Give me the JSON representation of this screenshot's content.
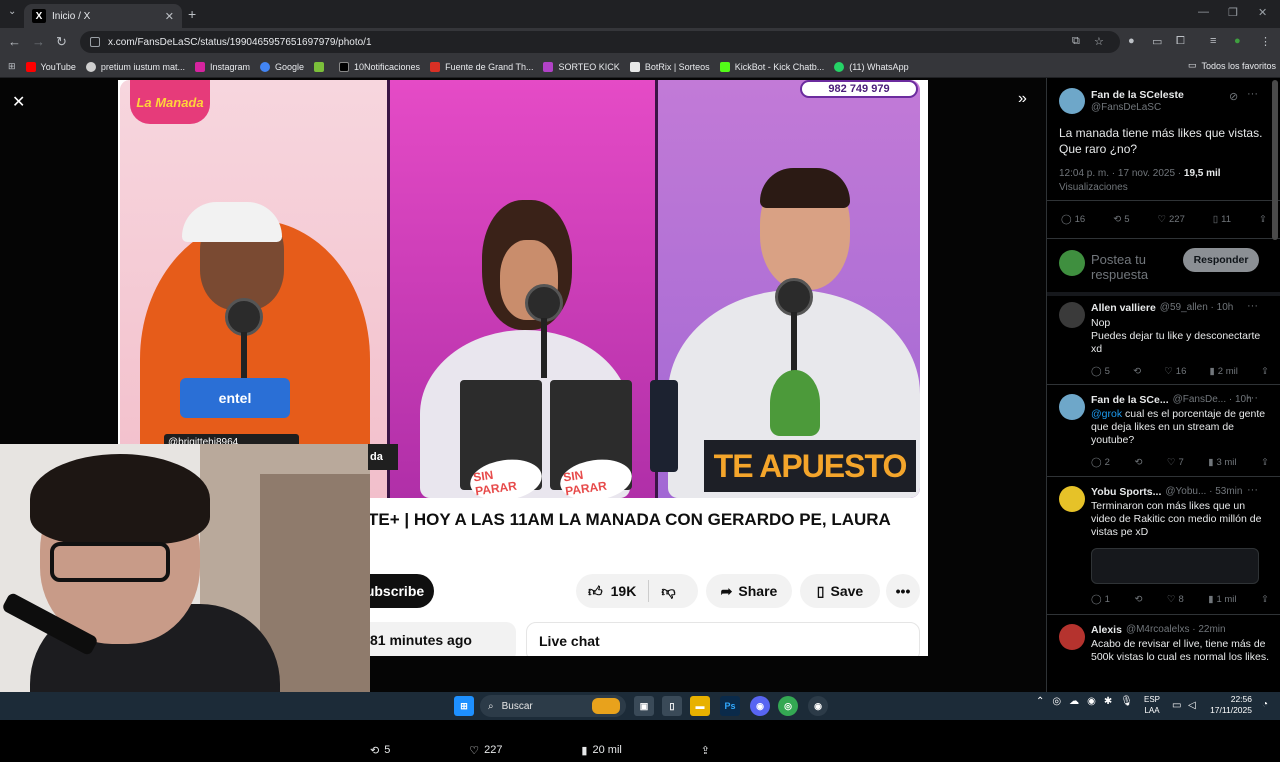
{
  "browser": {
    "tab_title": "Inicio / X",
    "url": "x.com/FansDeLaSC/status/1990465957651697979/photo/1",
    "bookmarks": [
      {
        "label": "YouTube",
        "color": "#ff0000"
      },
      {
        "label": "pretium iustum mat...",
        "color": "#cfcfcf"
      },
      {
        "label": "Instagram",
        "color": "#d6249f"
      },
      {
        "label": "Google",
        "color": "#4285f4"
      },
      {
        "label": "",
        "color": "#7bbf3a"
      },
      {
        "label": "10Notificaciones",
        "color": "#000000"
      },
      {
        "label": "Fuente de Grand Th...",
        "color": "#d93025"
      },
      {
        "label": "SORTEO KICK",
        "color": "#b142c7"
      },
      {
        "label": "BotRix | Sorteos",
        "color": "#e8e8e8"
      },
      {
        "label": "KickBot - Kick Chatb...",
        "color": "#53fc18"
      },
      {
        "label": "(11) WhatsApp",
        "color": "#25d366"
      }
    ],
    "all_bookmarks": "Todos los favoritos"
  },
  "stream": {
    "logo": "La Manada",
    "phone": "982 749 979",
    "sponsor": "entel",
    "overlay_user": "@brigittehj8964",
    "left_caption": "da",
    "show_name": "TE APUESTO",
    "product": "SIN PARAR"
  },
  "youtube": {
    "title": "TE+ | HOY A LAS 11AM LA MANADA CON GERARDO PE, LAURA",
    "subscribe": "ubscribe",
    "likes": "19K",
    "share": "Share",
    "save": "Save",
    "time_ago": "81 minutes ago",
    "live_chat": "Live chat"
  },
  "photo_actions": {
    "reposts": "5",
    "likes": "227",
    "views": "20 mil"
  },
  "tweet": {
    "author_name": "Fan de la SCeleste",
    "author_handle": "@FansDeLaSC",
    "text": "La manada tiene más likes que vistas. Que raro ¿no?",
    "timestamp": "12:04 p. m. · 17 nov. 2025 · ",
    "views_count": "19,5 mil",
    "views_label": "Visualizaciones",
    "replies": "16",
    "reposts": "5",
    "likes": "227",
    "bookmarks": "11",
    "compose_placeholder": "Postea tu respuesta",
    "reply_button": "Responder"
  },
  "replies": [
    {
      "name": "Allen valliere",
      "handle": "@59_allen · 10h",
      "mention": "",
      "text": "Nop\nPuedes dejar tu like y desconectarte xd",
      "replies": "5",
      "reposts": "",
      "likes": "16",
      "views": "2 mil",
      "avatar_color": "dark"
    },
    {
      "name": "Fan de la SCe...",
      "handle": "@FansDe... · 10h",
      "mention": "@grok",
      "text": " cual es el porcentaje de gente que deja likes en un stream de youtube?",
      "replies": "2",
      "reposts": "",
      "likes": "7",
      "views": "3 mil",
      "avatar_color": "blue"
    },
    {
      "name": "Yobu Sports...",
      "handle": "@Yobu... · 53min",
      "mention": "",
      "text": "Terminaron con más likes que un video de Rakitic con medio millón de vistas pe xD",
      "replies": "1",
      "reposts": "",
      "likes": "8",
      "views": "1 mil",
      "avatar_color": "yellow"
    },
    {
      "name": "Alexis",
      "handle": "@M4rcoalelxs · 22min",
      "mention": "",
      "text": "Acabo de revisar el live, tiene más de 500k vistas lo cual es normal los likes.",
      "replies": "",
      "reposts": "",
      "likes": "",
      "views": "",
      "avatar_color": "red"
    }
  ],
  "taskbar": {
    "search": "Buscar",
    "lang_top": "ESP",
    "lang_bottom": "LAA",
    "time": "22:56",
    "date": "17/11/2025"
  }
}
